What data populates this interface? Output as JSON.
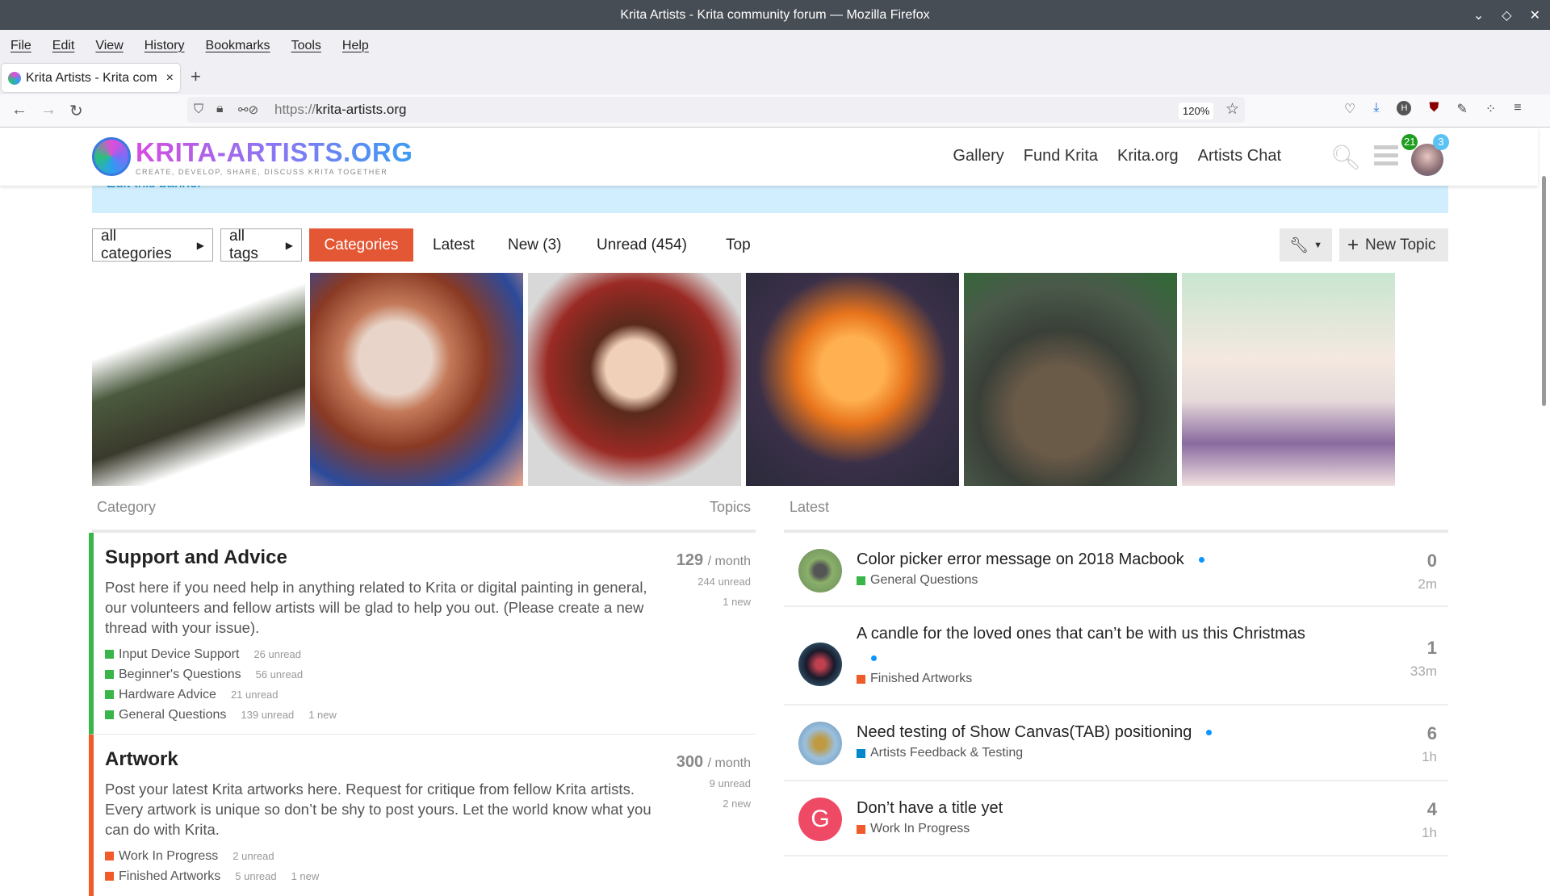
{
  "window": {
    "title": "Krita Artists - Krita community forum — Mozilla Firefox",
    "controls": [
      "⌄",
      "◇",
      "✕"
    ]
  },
  "menu": [
    "File",
    "Edit",
    "View",
    "History",
    "Bookmarks",
    "Tools",
    "Help"
  ],
  "tab": {
    "title": "Krita Artists - Krita com",
    "close": "×",
    "new": "+"
  },
  "nav": {
    "url_scheme": "https://",
    "url_host": "krita-artists.org",
    "zoom": "120%"
  },
  "site": {
    "logo_title": "KRITA-ARTISTS.ORG",
    "logo_tagline": "CREATE, DEVELOP, SHARE, DISCUSS KRITA TOGETHER",
    "links": [
      "Gallery",
      "Fund Krita",
      "Krita.org",
      "Artists Chat"
    ],
    "notifications": "21",
    "messages": "3"
  },
  "banner": {
    "text": "Edit this banner"
  },
  "filters": {
    "categories_dropdown": "all categories",
    "tags_dropdown": "all tags",
    "tabs": [
      "Categories",
      "Latest",
      "New (3)",
      "Unread (454)",
      "Top"
    ],
    "active_tab": "Categories",
    "new_topic": "New Topic"
  },
  "headers": {
    "category": "Category",
    "topics": "Topics",
    "latest": "Latest"
  },
  "categories": [
    {
      "name": "Support and Advice",
      "color": "#3ab54a",
      "count": "129",
      "period": "/ month",
      "unread": "244 unread",
      "new": "1 new",
      "description": "Post here if you need help in anything related to Krita or digital painting in general, our volunteers and fellow artists will be glad to help you out. (Please create a new thread with your issue).",
      "subcategories": [
        {
          "name": "Input Device Support",
          "unread": "26 unread",
          "new": ""
        },
        {
          "name": "Beginner's Questions",
          "unread": "56 unread",
          "new": ""
        },
        {
          "name": "Hardware Advice",
          "unread": "21 unread",
          "new": ""
        },
        {
          "name": "General Questions",
          "unread": "139 unread",
          "new": "1 new"
        }
      ]
    },
    {
      "name": "Artwork",
      "color": "#f15a2a",
      "count": "300",
      "period": "/ month",
      "unread": "9 unread",
      "new": "2 new",
      "description": "Post your latest Krita artworks here. Request for critique from fellow Krita artists. Every artwork is unique so don’t be shy to post yours. Let the world know what you can do with Krita.",
      "subcategories": [
        {
          "name": "Work In Progress",
          "unread": "2 unread",
          "new": ""
        },
        {
          "name": "Finished Artworks",
          "unread": "5 unread",
          "new": "1 new"
        }
      ]
    }
  ],
  "latest": [
    {
      "title": "Color picker error message on 2018 Macbook",
      "category": "General Questions",
      "cat_color": "#3ab54a",
      "replies": "0",
      "age": "2m"
    },
    {
      "title": "A candle for the loved ones that can’t be with us this Christmas",
      "category": "Finished Artworks",
      "cat_color": "#f15a2a",
      "replies": "1",
      "age": "33m"
    },
    {
      "title": "Need testing of Show Canvas(TAB) positioning",
      "category": "Artists Feedback & Testing",
      "cat_color": "#0088cc",
      "replies": "6",
      "age": "1h"
    },
    {
      "title": "Don’t have a title yet",
      "category": "Work In Progress",
      "cat_color": "#f15a2a",
      "replies": "4",
      "age": "1h",
      "avatar_letter": "G"
    }
  ]
}
